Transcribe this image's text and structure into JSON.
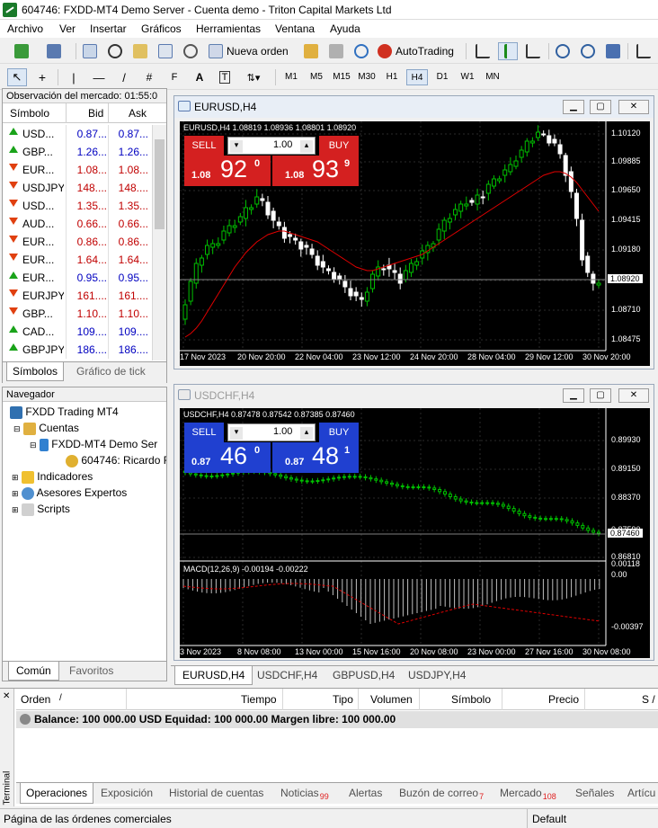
{
  "window": {
    "title": "604746: FXDD-MT4 Demo Server - Cuenta demo - Triton Capital Markets Ltd"
  },
  "menu": [
    "Archivo",
    "Ver",
    "Insertar",
    "Gráficos",
    "Herramientas",
    "Ventana",
    "Ayuda"
  ],
  "toolbar": {
    "new_order": "Nueva orden",
    "autotrading": "AutoTrading"
  },
  "timeframes": [
    "M1",
    "M5",
    "M15",
    "M30",
    "H1",
    "H4",
    "D1",
    "W1",
    "MN"
  ],
  "active_timeframe": "H4",
  "market_watch": {
    "title": "Observación del mercado: 01:55:0",
    "col_symbol": "Símbolo",
    "col_bid": "Bid",
    "col_ask": "Ask",
    "rows": [
      {
        "dir": "up",
        "symbol": "USD...",
        "bid": "0.87...",
        "ask": "0.87...",
        "color": "blue"
      },
      {
        "dir": "up",
        "symbol": "GBP...",
        "bid": "1.26...",
        "ask": "1.26...",
        "color": "blue"
      },
      {
        "dir": "down",
        "symbol": "EUR...",
        "bid": "1.08...",
        "ask": "1.08...",
        "color": "red"
      },
      {
        "dir": "down",
        "symbol": "USDJPY",
        "bid": "148....",
        "ask": "148....",
        "color": "red"
      },
      {
        "dir": "down",
        "symbol": "USD...",
        "bid": "1.35...",
        "ask": "1.35...",
        "color": "red"
      },
      {
        "dir": "down",
        "symbol": "AUD...",
        "bid": "0.66...",
        "ask": "0.66...",
        "color": "red"
      },
      {
        "dir": "down",
        "symbol": "EUR...",
        "bid": "0.86...",
        "ask": "0.86...",
        "color": "red"
      },
      {
        "dir": "down",
        "symbol": "EUR...",
        "bid": "1.64...",
        "ask": "1.64...",
        "color": "red"
      },
      {
        "dir": "up",
        "symbol": "EUR...",
        "bid": "0.95...",
        "ask": "0.95...",
        "color": "blue"
      },
      {
        "dir": "down",
        "symbol": "EURJPY",
        "bid": "161....",
        "ask": "161....",
        "color": "red"
      },
      {
        "dir": "down",
        "symbol": "GBP...",
        "bid": "1.10...",
        "ask": "1.10...",
        "color": "red"
      },
      {
        "dir": "up",
        "symbol": "CAD...",
        "bid": "109....",
        "ask": "109....",
        "color": "blue"
      },
      {
        "dir": "up",
        "symbol": "GBPJPY",
        "bid": "186....",
        "ask": "186....",
        "color": "blue"
      }
    ],
    "tabs": [
      "Símbolos",
      "Gráfico de tick"
    ]
  },
  "navigator": {
    "title": "Navegador",
    "items": [
      "FXDD Trading MT4",
      "Cuentas",
      "FXDD-MT4 Demo Ser",
      "604746: Ricardo F",
      "Indicadores",
      "Asesores Expertos",
      "Scripts"
    ],
    "tabs": [
      "Común",
      "Favoritos"
    ]
  },
  "chart1": {
    "window_title": "EURUSD,H4",
    "header": "EURUSD,H4  1.08819 1.08936 1.08801 1.08920",
    "sell_label": "SELL",
    "buy_label": "BUY",
    "lot": "1.00",
    "sell_price": {
      "prefix": "1.08",
      "big": "92",
      "sup": "0"
    },
    "buy_price": {
      "prefix": "1.08",
      "big": "93",
      "sup": "9"
    },
    "price_labels": [
      "1.10120",
      "1.09885",
      "1.09650",
      "1.09415",
      "1.09180",
      "1.08945",
      "1.08710",
      "1.08475"
    ],
    "current_price": "1.08920",
    "time_labels": [
      "17 Nov 2023",
      "20 Nov 20:00",
      "22 Nov 04:00",
      "23 Nov 12:00",
      "24 Nov 20:00",
      "28 Nov 04:00",
      "29 Nov 12:00",
      "30 Nov 20:00"
    ]
  },
  "chart2": {
    "window_title": "USDCHF,H4",
    "header": "USDCHF,H4  0.87478 0.87542 0.87385 0.87460",
    "sell_label": "SELL",
    "buy_label": "BUY",
    "lot": "1.00",
    "sell_price": {
      "prefix": "0.87",
      "big": "46",
      "sup": "0"
    },
    "buy_price": {
      "prefix": "0.87",
      "big": "48",
      "sup": "1"
    },
    "price_labels": [
      "0.89930",
      "0.89150",
      "0.88370",
      "0.87590",
      "0.86810"
    ],
    "current_price": "0.87460",
    "macd_header": "MACD(12,26,9) -0.00194 -0.00222",
    "macd_labels": [
      "0.00118",
      "0.00",
      "-0.00397"
    ],
    "time_labels": [
      "3 Nov 2023",
      "8 Nov 08:00",
      "13 Nov 00:00",
      "15 Nov 16:00",
      "20 Nov 08:00",
      "23 Nov 00:00",
      "27 Nov 16:00",
      "30 Nov 08:00"
    ]
  },
  "chart_tabs": [
    "EURUSD,H4",
    "USDCHF,H4",
    "GBPUSD,H4",
    "USDJPY,H4"
  ],
  "terminal": {
    "side_label": "Terminal",
    "columns": [
      "Orden",
      "/",
      "Tiempo",
      "Tipo",
      "Volumen",
      "Símbolo",
      "Precio",
      "S /"
    ],
    "balance": "Balance: 100 000.00 USD  Equidad: 100 000.00  Margen libre: 100 000.00",
    "tabs": [
      {
        "label": "Operaciones",
        "badge": ""
      },
      {
        "label": "Exposición",
        "badge": ""
      },
      {
        "label": "Historial de cuentas",
        "badge": ""
      },
      {
        "label": "Noticias",
        "badge": "99"
      },
      {
        "label": "Alertas",
        "badge": ""
      },
      {
        "label": "Buzón de correo",
        "badge": "7"
      },
      {
        "label": "Mercado",
        "badge": "108"
      },
      {
        "label": "Señales",
        "badge": ""
      },
      {
        "label": "Artícu",
        "badge": ""
      }
    ]
  },
  "status": {
    "left": "Página de las órdenes comerciales",
    "profile": "Default"
  },
  "colors": {
    "bull_candle": "#00c000",
    "bear_candle": "#ffffff",
    "ma_line": "#e00000",
    "sell_red": "#d42020",
    "buy_blue": "#2040d0"
  }
}
